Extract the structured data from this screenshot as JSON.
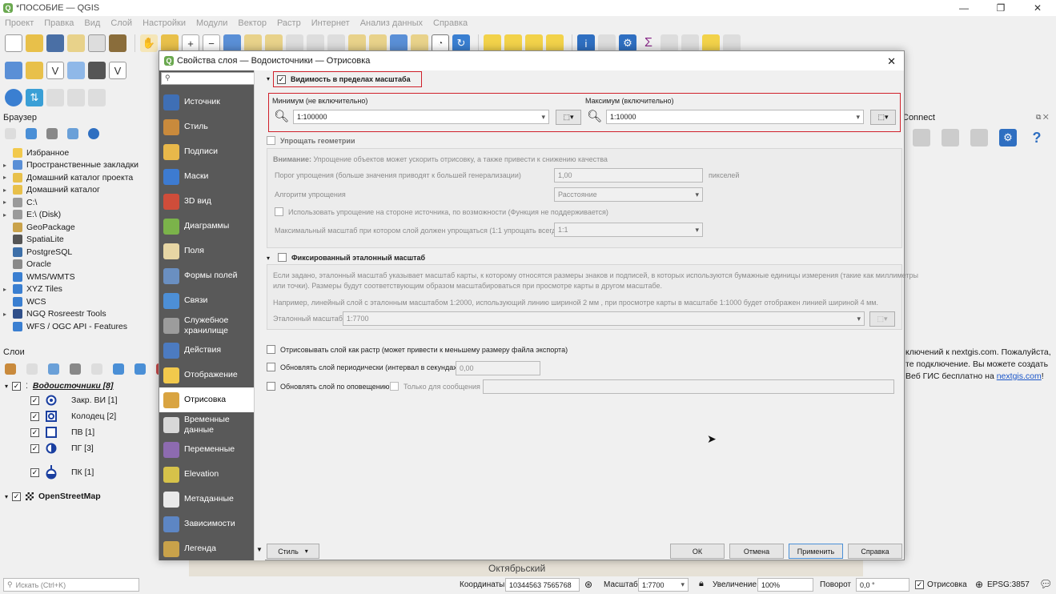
{
  "window": {
    "title": "*ПОСОБИЕ — QGIS",
    "min": "—",
    "max": "❐",
    "close": "✕"
  },
  "menu": [
    "Проект",
    "Правка",
    "Вид",
    "Слой",
    "Настройки",
    "Модули",
    "Вектор",
    "Растр",
    "Интернет",
    "Анализ данных",
    "Справка"
  ],
  "browser": {
    "title": "Браузер",
    "items": [
      {
        "label": "Избранное",
        "icon": "star-icon",
        "arrow": ""
      },
      {
        "label": "Пространственные закладки",
        "icon": "bookmark-icon",
        "arrow": "▸"
      },
      {
        "label": "Домашний каталог проекта",
        "icon": "folder-icon",
        "arrow": "▸"
      },
      {
        "label": "Домашний каталог",
        "icon": "folder-icon",
        "arrow": "▸"
      },
      {
        "label": "C:\\",
        "icon": "drive-icon",
        "arrow": "▸"
      },
      {
        "label": "E:\\ (Disk)",
        "icon": "drive-icon",
        "arrow": "▸"
      },
      {
        "label": "GeoPackage",
        "icon": "geopackage-icon",
        "arrow": ""
      },
      {
        "label": "SpatiaLite",
        "icon": "spatialite-icon",
        "arrow": ""
      },
      {
        "label": "PostgreSQL",
        "icon": "postgresql-icon",
        "arrow": ""
      },
      {
        "label": "Oracle",
        "icon": "oracle-icon",
        "arrow": ""
      },
      {
        "label": "WMS/WMTS",
        "icon": "wms-icon",
        "arrow": ""
      },
      {
        "label": "XYZ Tiles",
        "icon": "xyz-icon",
        "arrow": "▸"
      },
      {
        "label": "WCS",
        "icon": "wcs-icon",
        "arrow": ""
      },
      {
        "label": "NGQ Rosreestr Tools",
        "icon": "ngq-icon",
        "arrow": "▸"
      },
      {
        "label": "WFS / OGC API - Features",
        "icon": "wfs-icon",
        "arrow": ""
      }
    ]
  },
  "layers": {
    "title": "Слои",
    "group": "Водоисточники [8]",
    "items": [
      {
        "label": "Закр. ВИ [1]",
        "sym": "circle-dot"
      },
      {
        "label": "Колодец [2]",
        "sym": "square-circle"
      },
      {
        "label": "ПВ [1]",
        "sym": "square"
      },
      {
        "label": "ПГ [3]",
        "sym": "half-circle"
      },
      {
        "label": "ПК [1]",
        "sym": "drop"
      }
    ],
    "osm": "OpenStreetMap"
  },
  "right_panel": {
    "title": "Connect",
    "text1": "ключений к nextgis.com. Пожалуйста,",
    "text2": "те подключение. Вы можете создать",
    "text3": "Веб ГИС бесплатно на ",
    "link": "nextgis.com",
    "text4": "!"
  },
  "map": {
    "label": "Октябрьский"
  },
  "dialog": {
    "title": "Свойства слоя — Водоисточники — Отрисовка",
    "close": "✕",
    "search_placeholder": "",
    "tabs": [
      {
        "label": "Источник",
        "color": "#3f6fb5"
      },
      {
        "label": "Стиль",
        "color": "#c98a3c"
      },
      {
        "label": "Подписи",
        "color": "#e8b84a"
      },
      {
        "label": "Маски",
        "color": "#3d7bd1"
      },
      {
        "label": "3D вид",
        "color": "#cf4d3a"
      },
      {
        "label": "Диаграммы",
        "color": "#7bb34a"
      },
      {
        "label": "Поля",
        "color": "#e7d6a4"
      },
      {
        "label": "Формы полей",
        "color": "#6a8fc1"
      },
      {
        "label": "Связи",
        "color": "#4d8fd6"
      },
      {
        "label": "Служебное хранилище",
        "color": "#9c9c9c"
      },
      {
        "label": "Действия",
        "color": "#4c7bc1"
      },
      {
        "label": "Отображение",
        "color": "#f2c94c"
      },
      {
        "label": "Отрисовка",
        "color": "#d9a441",
        "selected": true
      },
      {
        "label": "Временные данные",
        "color": "#d8d8d8"
      },
      {
        "label": "Переменные",
        "color": "#8d6bb0"
      },
      {
        "label": "Elevation",
        "color": "#d6c24a"
      },
      {
        "label": "Метаданные",
        "color": "#e9e9e9"
      },
      {
        "label": "Зависимости",
        "color": "#5d86c4"
      },
      {
        "label": "Легенда",
        "color": "#c9a24a"
      }
    ],
    "scale_vis": {
      "label": "Видимость в пределах масштаба",
      "checked": true,
      "min_label": "Минимум (не включительно)",
      "min_value": "1:100000",
      "max_label": "Максимум (включительно)",
      "max_value": "1:10000"
    },
    "simplify": {
      "label": "Упрощать геометрии",
      "warning_bold": "Внимание:",
      "warning": " Упрощение объектов может ускорить отрисовку, а также привести к снижению качества",
      "threshold_label": "Порог упрощения (больше значения приводят к большей генерализации)",
      "threshold_value": "1,00",
      "threshold_unit": "пикселей",
      "algo_label": "Алгоритм упрощения",
      "algo_value": "Расстояние",
      "provider_label": "Использовать упрощение на стороне источника, по возможности (Функция не поддерживается)",
      "maxscale_label": "Максимальный масштаб при котором слой должен упрощаться (1:1 упрощать всегда)",
      "maxscale_value": "1:1"
    },
    "refscale": {
      "label": "Фиксированный эталонный масштаб",
      "desc1": "Если задано, эталонный масштаб указывает масштаб карты, к которому относятся размеры знаков и подписей, в которых используются бумажные единицы измерения (такие как миллиметры",
      "desc2": "или точки). Размеры будут соответствующим образом масштабироваться при просмотре карты в другом масштабе.",
      "example": "Например, линейный слой с эталонным масштабом 1:2000, использующий линию шириной 2 мм , при просмотре карты в масштабе 1:1000 будет отображен линией шириной 4 мм.",
      "field_label": "Эталонный масштаб",
      "field_value": "1:7700"
    },
    "raster_label": "Отрисовывать слой как растр (может привести к меньшему размеру файла экспорта)",
    "refresh_label": "Обновлять слой периодически (интервал в секундах)",
    "refresh_value": "0,00",
    "notify_label": "Обновлять слой по оповещению",
    "notify_only": "Только для сообщения",
    "buttons": {
      "style": "Стиль",
      "ok": "ОК",
      "cancel": "Отмена",
      "apply": "Применить",
      "help": "Справка"
    }
  },
  "status": {
    "search_placeholder": "Искать (Ctrl+K)",
    "coords_label": "Координаты",
    "coords_value": "10344563 7565768",
    "scale_label": "Масштаб",
    "scale_value": "1:7700",
    "mag_label": "Увеличение",
    "mag_value": "100%",
    "rot_label": "Поворот",
    "rot_value": "0,0 °",
    "render_label": "Отрисовка",
    "crs": "EPSG:3857"
  },
  "colors": {
    "accent_red": "#d0202a",
    "sidebar": "#595959"
  }
}
